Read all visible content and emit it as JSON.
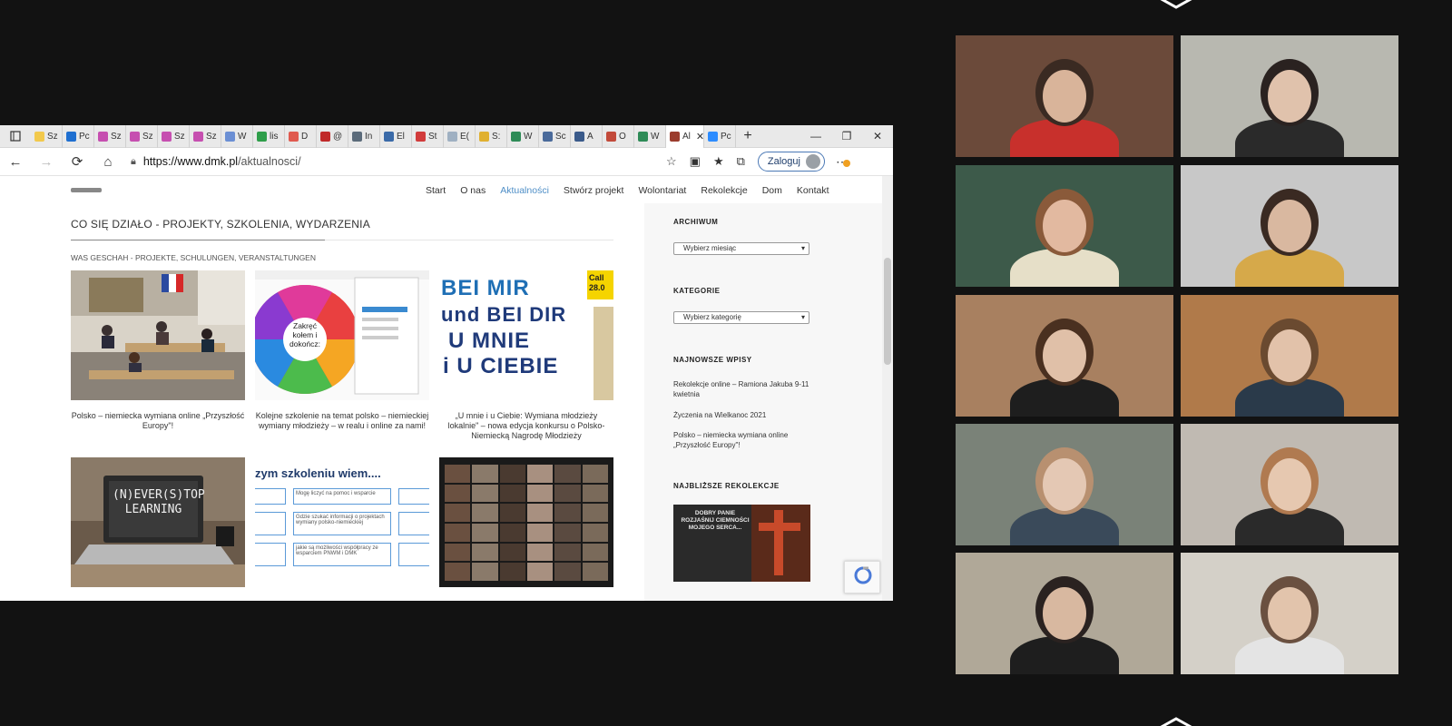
{
  "browser": {
    "tabs": [
      {
        "label": "Sz",
        "color": "#f2c94c"
      },
      {
        "label": "Pc",
        "color": "#1f6fd0"
      },
      {
        "label": "Sz",
        "color": "#c64fb0"
      },
      {
        "label": "Sz",
        "color": "#c64fb0"
      },
      {
        "label": "Sz",
        "color": "#c64fb0"
      },
      {
        "label": "Sz",
        "color": "#c64fb0"
      },
      {
        "label": "W",
        "color": "#6b8fd4"
      },
      {
        "label": "lis",
        "color": "#2e9e4a"
      },
      {
        "label": "D",
        "color": "#e05a4f"
      },
      {
        "label": "@",
        "color": "#c02a2a"
      },
      {
        "label": "In",
        "color": "#5b6b7a"
      },
      {
        "label": "El",
        "color": "#3a6aa8"
      },
      {
        "label": "St",
        "color": "#d13b3b"
      },
      {
        "label": "E(",
        "color": "#9fb0c2"
      },
      {
        "label": "S:",
        "color": "#e0b030"
      },
      {
        "label": "W",
        "color": "#2e8b57"
      },
      {
        "label": "Sc",
        "color": "#4a6a9a"
      },
      {
        "label": "A",
        "color": "#3a5a8a"
      },
      {
        "label": "O",
        "color": "#c24a3a"
      },
      {
        "label": "W",
        "color": "#2e8b57"
      }
    ],
    "active_tab": {
      "label": "Al",
      "color": "#9b3c2d"
    },
    "after_tab": {
      "label": "Pc",
      "color": "#2d8cff"
    },
    "url_host": "https://www.dmk.pl",
    "url_path": "/aktualnosci/",
    "login_label": "Zaloguj"
  },
  "site": {
    "nav": [
      "Start",
      "O nas",
      "Aktualności",
      "Stwórz projekt",
      "Wolontariat",
      "Rekolekcje",
      "Dom",
      "Kontakt"
    ],
    "current_nav": "Aktualności",
    "title": "CO SIĘ DZIAŁO - PROJEKTY, SZKOLENIA, WYDARZENIA",
    "subtitle": "WAS GESCHAH - PROJEKTE, SCHULUNGEN, VERANSTALTUNGEN",
    "posts": [
      {
        "caption": "Polsko – niemiecka wymiana online „Przyszłość Europy\"!"
      },
      {
        "caption": "Kolejne szkolenie na temat polsko – niemieckiej wymiany młodzieży – w realu i online za nami!",
        "wheel_text": "Zakręć kołem i dokończ:"
      },
      {
        "caption": "„U mnie i u Ciebie: Wymiana młodzieży lokalnie\" – nowa edycja konkursu o Polsko-Niemiecką Nagrodę Młodzieży",
        "poster_lines": [
          "BEI MIR",
          "und BEI DIR",
          "U MNIE",
          "i U CIEBIE"
        ],
        "badge": "Call 28.0"
      },
      {
        "caption": "",
        "laptop_text": "(N)EVER(S)TOP LEARNING"
      },
      {
        "caption": "",
        "slide_title": "zym szkoleniu wiem....",
        "slide_boxes": [
          "Mogę liczyć na pomoc i wsparcie",
          "Gdzie szukać informacji o projektach wymiany polsko-niemieckiej",
          "jakie są możliwości współpracy ze wsparciem PNWM i DMK"
        ]
      },
      {
        "caption": ""
      }
    ],
    "sidebar": {
      "archive_heading": "ARCHIWUM",
      "archive_select": "Wybierz miesiąc",
      "categories_heading": "KATEGORIE",
      "categories_select": "Wybierz kategorię",
      "recent_heading": "NAJNOWSZE WPISY",
      "recent_posts": [
        "Rekolekcje online – Ramiona Jakuba 9-11 kwietnia",
        "Życzenia na Wielkanoc 2021",
        "Polsko – niemiecka wymiana online „Przyszłość Europy\"!"
      ],
      "retreats_heading": "NAJBLIŻSZE REKOLEKCJE",
      "retreat_banner_text": "DOBRY PANIE ROZJAŚNIJ CIEMNOŚCI MOJEGO SERCA..."
    }
  },
  "video_grid": {
    "participants": [
      {
        "bg": "#6b4a3a",
        "shirt": "#c8302c",
        "hair": "#3a2a22",
        "skin": "#d9b49a"
      },
      {
        "bg": "#b8b8b0",
        "shirt": "#2a2a2a",
        "hair": "#2a2220",
        "skin": "#e0c2ac"
      },
      {
        "bg": "#3d5a4a",
        "shirt": "#e6dfc8",
        "hair": "#8a5a3a",
        "skin": "#e2b9a0"
      },
      {
        "bg": "#c8c8c8",
        "shirt": "#d6a94a",
        "hair": "#3a2a22",
        "skin": "#d9b8a0"
      },
      {
        "bg": "#a88060",
        "shirt": "#1e1e1e",
        "hair": "#4a3020",
        "skin": "#e0c0a8"
      },
      {
        "bg": "#b07a4a",
        "shirt": "#2a3a4a",
        "hair": "#6a4a30",
        "skin": "#e2c2aa"
      },
      {
        "bg": "#7a8278",
        "shirt": "#3a4a5a",
        "hair": "#b89070",
        "skin": "#e4c8b4"
      },
      {
        "bg": "#c0bab2",
        "shirt": "#2a2a2a",
        "hair": "#b07a50",
        "skin": "#e6c8b0"
      },
      {
        "bg": "#b0a898",
        "shirt": "#1e1e1e",
        "hair": "#2a2220",
        "skin": "#d8b8a0"
      },
      {
        "bg": "#d4d0c8",
        "shirt": "#e4e4e4",
        "hair": "#6a5040",
        "skin": "#e2c4ac"
      }
    ]
  }
}
